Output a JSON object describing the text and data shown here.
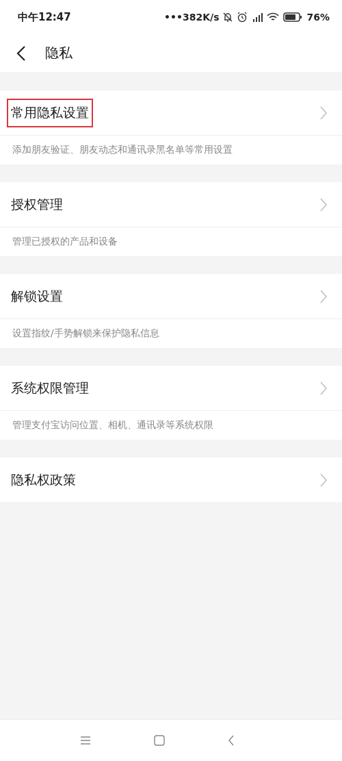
{
  "status_bar": {
    "time": "中午12:47",
    "speed": "•••382K/s",
    "battery": "76%"
  },
  "header": {
    "title": "隐私"
  },
  "items": [
    {
      "title": "常用隐私设置",
      "description": "添加朋友验证、朋友动态和通讯录黑名单等常用设置",
      "highlighted": true
    },
    {
      "title": "授权管理",
      "description": "管理已授权的产品和设备",
      "highlighted": false
    },
    {
      "title": "解锁设置",
      "description": "设置指纹/手势解锁来保护隐私信息",
      "highlighted": false
    },
    {
      "title": "系统权限管理",
      "description": "管理支付宝访问位置、相机、通讯录等系统权限",
      "highlighted": false
    },
    {
      "title": "隐私权政策",
      "highlighted": false
    }
  ]
}
